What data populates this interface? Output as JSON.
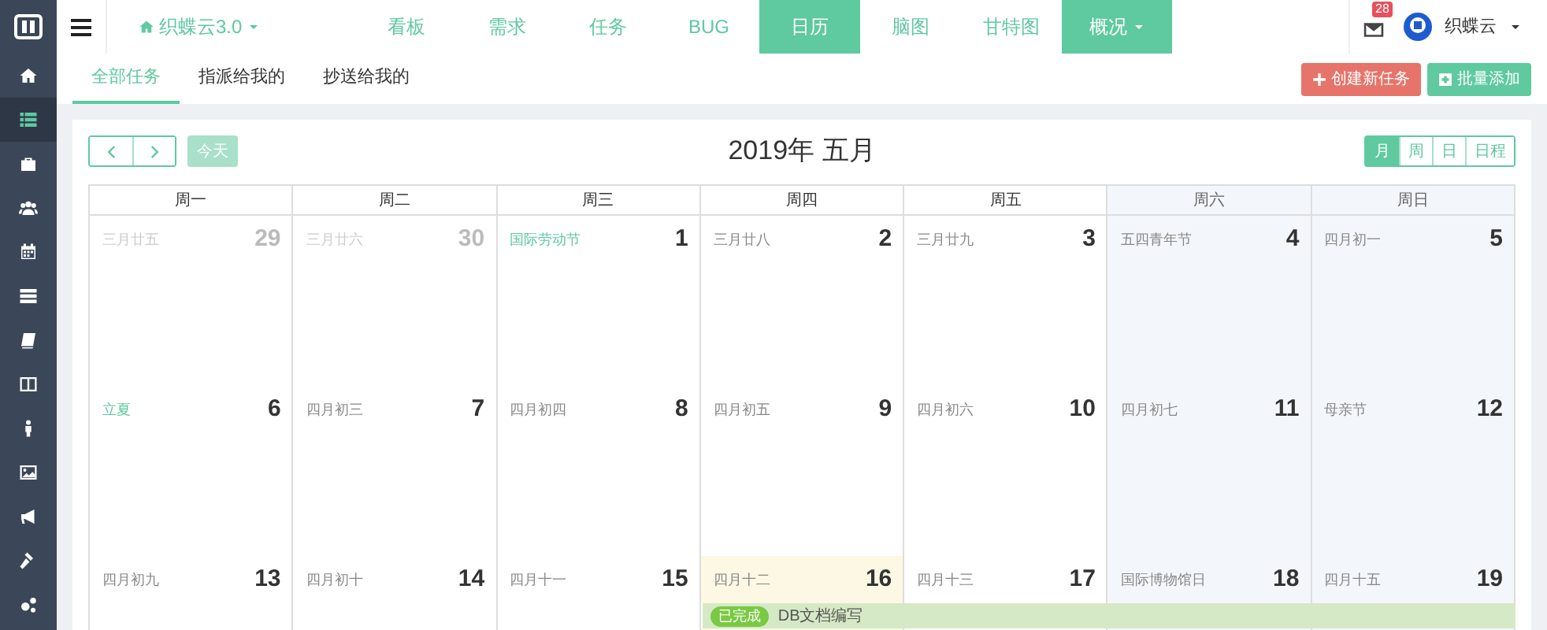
{
  "sidebar": {
    "items": [
      {
        "selected": false
      },
      {
        "selected": true
      },
      {
        "selected": false
      },
      {
        "selected": false
      },
      {
        "selected": false
      },
      {
        "selected": false
      },
      {
        "selected": false
      },
      {
        "selected": false
      },
      {
        "selected": false
      },
      {
        "selected": false
      },
      {
        "selected": false
      },
      {
        "selected": false
      },
      {
        "selected": false
      }
    ]
  },
  "navbar": {
    "brand": "织蝶云3.0",
    "items": [
      {
        "label": "看板",
        "selected": false,
        "kind": "link"
      },
      {
        "label": "需求",
        "selected": false,
        "kind": "link"
      },
      {
        "label": "任务",
        "selected": false,
        "kind": "link"
      },
      {
        "label": "BUG",
        "selected": false,
        "kind": "link"
      },
      {
        "label": "日历",
        "selected": true,
        "kind": "link"
      },
      {
        "label": "脑图",
        "selected": false,
        "kind": "link"
      },
      {
        "label": "甘特图",
        "selected": false,
        "kind": "link"
      },
      {
        "label": "概况",
        "selected": true,
        "kind": "dropdown"
      }
    ],
    "notification_count": "28",
    "user": "织蝶云"
  },
  "subtabs": [
    {
      "label": "全部任务",
      "selected": true
    },
    {
      "label": "指派给我的",
      "selected": false
    },
    {
      "label": "抄送给我的",
      "selected": false
    }
  ],
  "actions": [
    {
      "label": "创建新任务",
      "kind": "create"
    },
    {
      "label": "批量添加",
      "kind": "batch"
    }
  ],
  "calendar": {
    "today_button": "今天",
    "title": "2019年 五月",
    "views": [
      {
        "label": "月",
        "selected": true
      },
      {
        "label": "周",
        "selected": false
      },
      {
        "label": "日",
        "selected": false
      },
      {
        "label": "日程",
        "selected": false
      }
    ],
    "weekdays": [
      {
        "label": "周一",
        "weekend": false
      },
      {
        "label": "周二",
        "weekend": false
      },
      {
        "label": "周三",
        "weekend": false
      },
      {
        "label": "周四",
        "weekend": false
      },
      {
        "label": "周五",
        "weekend": false
      },
      {
        "label": "周六",
        "weekend": true
      },
      {
        "label": "周日",
        "weekend": true
      }
    ],
    "weeks": [
      {
        "days": [
          {
            "day": "29",
            "lunar": "三月廿五",
            "other_month": true,
            "holiday": false,
            "today": false
          },
          {
            "day": "30",
            "lunar": "三月廿六",
            "other_month": true,
            "holiday": false,
            "today": false
          },
          {
            "day": "1",
            "lunar": "国际劳动节",
            "other_month": false,
            "holiday": true,
            "today": false
          },
          {
            "day": "2",
            "lunar": "三月廿八",
            "other_month": false,
            "holiday": false,
            "today": false
          },
          {
            "day": "3",
            "lunar": "三月廿九",
            "other_month": false,
            "holiday": false,
            "today": false
          },
          {
            "day": "4",
            "lunar": "五四青年节",
            "other_month": false,
            "holiday": false,
            "today": false
          },
          {
            "day": "5",
            "lunar": "四月初一",
            "other_month": false,
            "holiday": false,
            "today": false
          }
        ]
      },
      {
        "days": [
          {
            "day": "6",
            "lunar": "立夏",
            "other_month": false,
            "holiday": true,
            "today": false
          },
          {
            "day": "7",
            "lunar": "四月初三",
            "other_month": false,
            "holiday": false,
            "today": false
          },
          {
            "day": "8",
            "lunar": "四月初四",
            "other_month": false,
            "holiday": false,
            "today": false
          },
          {
            "day": "9",
            "lunar": "四月初五",
            "other_month": false,
            "holiday": false,
            "today": false
          },
          {
            "day": "10",
            "lunar": "四月初六",
            "other_month": false,
            "holiday": false,
            "today": false
          },
          {
            "day": "11",
            "lunar": "四月初七",
            "other_month": false,
            "holiday": false,
            "today": false
          },
          {
            "day": "12",
            "lunar": "母亲节",
            "other_month": false,
            "holiday": false,
            "today": false
          }
        ]
      },
      {
        "days": [
          {
            "day": "13",
            "lunar": "四月初九",
            "other_month": false,
            "holiday": false,
            "today": false
          },
          {
            "day": "14",
            "lunar": "四月初十",
            "other_month": false,
            "holiday": false,
            "today": false
          },
          {
            "day": "15",
            "lunar": "四月十一",
            "other_month": false,
            "holiday": false,
            "today": false
          },
          {
            "day": "16",
            "lunar": "四月十二",
            "other_month": false,
            "holiday": false,
            "today": true,
            "event": {
              "status": "已完成",
              "title": "DB文档编写"
            }
          },
          {
            "day": "17",
            "lunar": "四月十三",
            "other_month": false,
            "holiday": false,
            "today": false
          },
          {
            "day": "18",
            "lunar": "国际博物馆日",
            "other_month": false,
            "holiday": false,
            "today": false
          },
          {
            "day": "19",
            "lunar": "四月十五",
            "other_month": false,
            "holiday": false,
            "today": false
          }
        ]
      }
    ]
  }
}
